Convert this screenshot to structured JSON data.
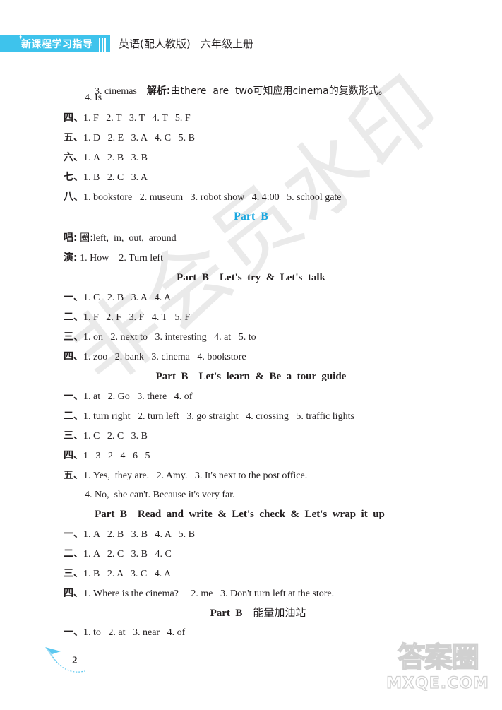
{
  "header": {
    "series_title": "新课程学习指导",
    "book_title": "英语(配人教版)   六年级上册",
    "accent_color": "#3ec3ec"
  },
  "lines": {
    "l1": {
      "num": "3. cinemas",
      "label": "解析:",
      "text": "由there  are  two可知应用cinema的复数形式。"
    },
    "l2": "4. Is",
    "l3": {
      "prefix": "四、",
      "text": "1. F   2. T   3. T   4. T   5. F"
    },
    "l4": {
      "prefix": "五、",
      "text": "1. D   2. E   3. A   4. C   5. B"
    },
    "l5": {
      "prefix": "六、",
      "text": "1. A   2. B   3. B"
    },
    "l6": {
      "prefix": "七、",
      "text": "1. B   2. C   3. A"
    },
    "l7": {
      "prefix": "八、",
      "text": "1. bookstore   2. museum   3. robot show   4. 4:00   5. school gate"
    }
  },
  "part_b": {
    "title": "Part  B",
    "sing": {
      "prefix": "唱:",
      "label": "圈:",
      "text": "left,  in,  out,  around"
    },
    "act": {
      "prefix": "演:",
      "text": "1. How    2. Turn left"
    }
  },
  "section1": {
    "title": "Part  B    Let's  try  &  Let's  talk",
    "rows": [
      {
        "prefix": "一、",
        "text": "1. C   2. B   3. A   4. A"
      },
      {
        "prefix": "二、",
        "text": "1. F   2. F   3. F   4. T   5. F"
      },
      {
        "prefix": "三、",
        "text": "1. on   2. next to   3. interesting   4. at   5. to"
      },
      {
        "prefix": "四、",
        "text": "1. zoo   2. bank   3. cinema   4. bookstore"
      }
    ]
  },
  "section2": {
    "title": "Part  B    Let's  learn  &  Be  a  tour  guide",
    "rows": [
      {
        "prefix": "一、",
        "text": "1. at   2. Go   3. there   4. of"
      },
      {
        "prefix": "二、",
        "text": "1. turn right   2. turn left   3. go straight   4. crossing   5. traffic lights"
      },
      {
        "prefix": "三、",
        "text": "1. C   2. C   3. B"
      },
      {
        "prefix": "四、",
        "text": "1   3   2   4   6   5"
      },
      {
        "prefix": "五、",
        "text": "1. Yes,  they are.   2. Amy.   3. It's next to the post office."
      }
    ],
    "continuation": "4. No,  she can't. Because it's very far."
  },
  "section3": {
    "title": "Part  B    Read  and  write  &  Let's  check  &  Let's  wrap  it  up",
    "rows": [
      {
        "prefix": "一、",
        "text": "1. A   2. B   3. B   4. A   5. B"
      },
      {
        "prefix": "二、",
        "text": "1. A   2. C   3. B   4. C"
      },
      {
        "prefix": "三、",
        "text": "1. B   2. A   3. C   4. A"
      },
      {
        "prefix": "四、",
        "text": "1. Where is the cinema?     2. me   3. Don't turn left at the store."
      }
    ]
  },
  "section4": {
    "title_en": "Part  B",
    "title_cn": "能量加油站",
    "rows": [
      {
        "prefix": "一、",
        "text": "1. to   2. at   3. near   4. of"
      }
    ]
  },
  "footer": {
    "page_number": "2"
  },
  "watermarks": {
    "diagonal": "非会员水印",
    "site_cn": "答案圈",
    "site_url": "MXQE.COM"
  }
}
